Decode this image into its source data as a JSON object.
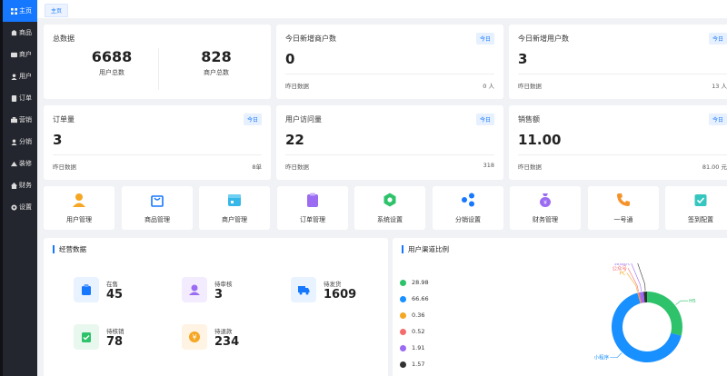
{
  "sidebar": {
    "items": [
      {
        "label": "主页",
        "icon": "grid-icon",
        "active": true
      },
      {
        "label": "商品",
        "icon": "goods-icon"
      },
      {
        "label": "商户",
        "icon": "merchant-icon"
      },
      {
        "label": "用户",
        "icon": "user-icon"
      },
      {
        "label": "订单",
        "icon": "order-icon"
      },
      {
        "label": "营销",
        "icon": "marketing-icon"
      },
      {
        "label": "分销",
        "icon": "distribution-icon"
      },
      {
        "label": "装修",
        "icon": "decoration-icon"
      },
      {
        "label": "财务",
        "icon": "finance-icon"
      },
      {
        "label": "设置",
        "icon": "settings-icon"
      }
    ]
  },
  "tabs": {
    "home": "主页"
  },
  "totals": {
    "title": "总数据",
    "users_value": "6688",
    "users_label": "用户总数",
    "merchants_value": "828",
    "merchants_label": "商户总数"
  },
  "today_badge": "今日",
  "yesterday_label": "昨日数据",
  "cards": {
    "new_merchants": {
      "title": "今日新增商户数",
      "value": "0",
      "yesterday": "0 人"
    },
    "new_users": {
      "title": "今日新增用户数",
      "value": "3",
      "yesterday": "13 人"
    },
    "orders": {
      "title": "订单量",
      "value": "3",
      "yesterday": "8单"
    },
    "visits": {
      "title": "用户访问量",
      "value": "22",
      "yesterday": "318"
    },
    "sales": {
      "title": "销售额",
      "value": "11.00",
      "yesterday": "81.00 元"
    }
  },
  "shortcuts": [
    {
      "label": "用户管理",
      "icon": "user-manage-icon",
      "color": "#f5a623"
    },
    {
      "label": "商品管理",
      "icon": "shopping-bag-icon",
      "color": "#1677ff"
    },
    {
      "label": "商户管理",
      "icon": "store-icon",
      "color": "#36b7e8"
    },
    {
      "label": "订单管理",
      "icon": "clipboard-icon",
      "color": "#9b6cf2"
    },
    {
      "label": "系统设置",
      "icon": "hexagon-settings-icon",
      "color": "#2ec26a"
    },
    {
      "label": "分销设置",
      "icon": "share-icon",
      "color": "#1677ff"
    },
    {
      "label": "财务管理",
      "icon": "money-bag-icon",
      "color": "#9b6cf2"
    },
    {
      "label": "一号通",
      "icon": "phone-icon",
      "color": "#f5922a"
    },
    {
      "label": "签到配置",
      "icon": "check-calendar-icon",
      "color": "#36c6c0"
    }
  ],
  "business": {
    "title": "经营数据",
    "stats": [
      {
        "label": "在售",
        "value": "45",
        "icon": "sale-icon",
        "bg": "#e8f3ff",
        "color": "#1677ff"
      },
      {
        "label": "待审核",
        "value": "3",
        "icon": "review-icon",
        "bg": "#f3ecff",
        "color": "#9b6cf2"
      },
      {
        "label": "待发货",
        "value": "1609",
        "icon": "truck-icon",
        "bg": "#e8f3ff",
        "color": "#1677ff"
      },
      {
        "label": "待核销",
        "value": "78",
        "icon": "verify-icon",
        "bg": "#e9f8ef",
        "color": "#2ec26a"
      },
      {
        "label": "待退款",
        "value": "234",
        "icon": "refund-icon",
        "bg": "#fff3e3",
        "color": "#f5a623"
      }
    ]
  },
  "channel": {
    "title": "用户渠道比例"
  },
  "chart_data": {
    "type": "pie",
    "donut": true,
    "series": [
      {
        "value": 28.98,
        "color": "#2ec26a",
        "label": "H5"
      },
      {
        "value": 66.66,
        "color": "#1890ff",
        "label": "小程序"
      },
      {
        "value": 0.36,
        "color": "#f5a623",
        "label": "PC"
      },
      {
        "value": 0.52,
        "color": "#f56c6c",
        "label": "公众号"
      },
      {
        "value": 1.91,
        "color": "#9b6cf2",
        "label": "微信pc"
      },
      {
        "value": 1.57,
        "color": "#333333",
        "label": "微信安卓"
      }
    ]
  }
}
